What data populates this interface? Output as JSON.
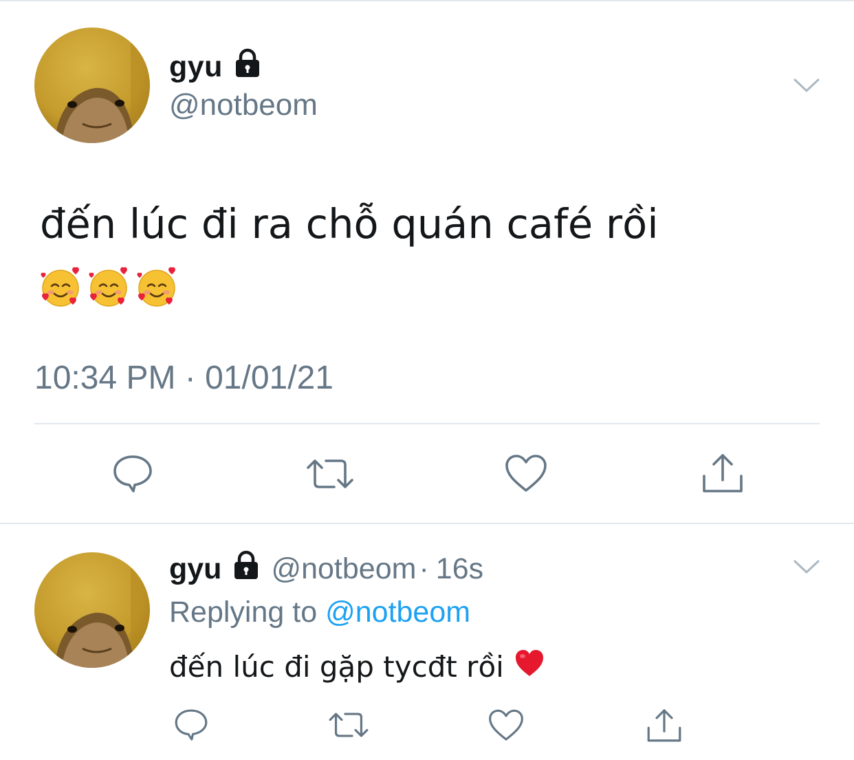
{
  "main_tweet": {
    "author_name": "gyu",
    "author_handle": "@notbeom",
    "locked": true,
    "text": "đến lúc đi ra chỗ quán café rồi",
    "emojis": [
      "smiling-face-with-hearts",
      "smiling-face-with-hearts",
      "smiling-face-with-hearts"
    ],
    "timestamp": "10:34 PM · 01/01/21",
    "actions": [
      "reply-icon",
      "retweet-icon",
      "like-icon",
      "share-icon"
    ]
  },
  "reply_tweet": {
    "author_name": "gyu",
    "author_handle": "@notbeom",
    "separator": "·",
    "age": "16s",
    "replying_prefix": "Replying to",
    "replying_handle": "@notbeom",
    "text": "đến lúc đi gặp tycđt rồi",
    "trailing_emoji": "red-heart",
    "actions": [
      "reply-icon",
      "retweet-icon",
      "like-icon",
      "share-icon"
    ]
  },
  "colors": {
    "text_primary": "#14171a",
    "text_secondary": "#657786",
    "link": "#1da1f2",
    "divider": "#e1e8ed",
    "avatar_bg": "#c9a435"
  }
}
